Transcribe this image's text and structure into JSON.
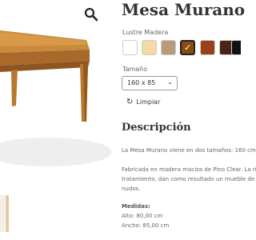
{
  "product": {
    "title": "Mesa Murano",
    "color_label": "Lustre Madera",
    "swatches": [
      {
        "color": "#ffffff"
      },
      {
        "color": "#f2d9a8"
      },
      {
        "color": "#b99a7a"
      },
      {
        "color": "#8a4b12",
        "selected": true
      },
      {
        "color": "#9a4018"
      },
      {
        "color": "#4a2513"
      },
      {
        "color": "#111111"
      }
    ],
    "size_label": "Tamaño",
    "size_value": "160 x 85",
    "reset_label": "Limpiar"
  },
  "description": {
    "heading": "Descripción",
    "p1": "La Mesa Murano viene en dos tamaños: 160 cm",
    "p2_line1": "Fabricada en madera maciza de Pino Clear. La ri",
    "p2_line2": "tratamiento, dan como resultado un mueble de",
    "p2_line3": "nudos.",
    "measures_label": "Medidas:",
    "height": "Alto: 80,00 cm",
    "width": "Ancho: 85,00 cm"
  },
  "icons": {
    "zoom": "magnifier-icon",
    "reset": "refresh-icon"
  }
}
